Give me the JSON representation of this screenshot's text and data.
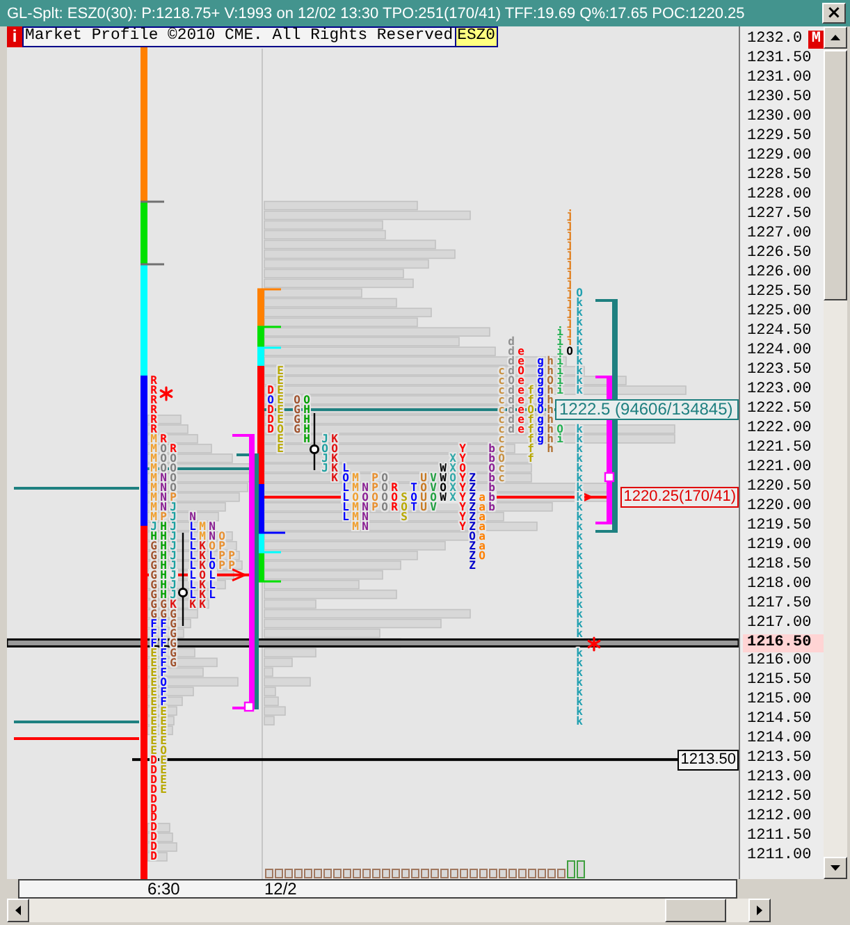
{
  "window": {
    "title": "GL-Splt: ESZ0(30): P:1218.75+ V:1993 on 12/02 13:30 TPO:251(170/41) TFF:19.69 Q%:17.65 POC:1220.25",
    "close_button": "×"
  },
  "header": {
    "info_button": "i",
    "notice": "Market Profile ©2010 CME. All Rights Reserved",
    "symbol": "ESZ0"
  },
  "chart": {
    "sessions": [
      {
        "columns": [
          {
            "runs": [
              {
                "text": "RRRRRR",
                "color": "#ff0000"
              },
              {
                "text": "MMMMMMMMM",
                "color": "#f0a030"
              },
              {
                "text": "J",
                "color": "#1ca0a0"
              },
              {
                "text": "H",
                "color": "#00a000"
              },
              {
                "text": "GGGGGGGG",
                "color": "#a0522d"
              },
              {
                "text": "FFF",
                "color": "#0000ff"
              },
              {
                "text": "EEEEEEEEEEE",
                "color": "#b8a800"
              },
              {
                "text": "DDDDDDDDDDD",
                "color": "#ff0000"
              }
            ]
          },
          {
            "runs": [
              {
                "text": "R",
                "color": "#ff0000"
              },
              {
                "text": "OOO",
                "color": "#808080"
              },
              {
                "text": "NNNN",
                "color": "#8b2094"
              },
              {
                "text": "P",
                "color": "#e89030"
              },
              {
                "text": "HHHHHHHH",
                "color": "#00a000"
              },
              {
                "text": "GG",
                "color": "#a0522d"
              },
              {
                "text": "FFFFFFOFF",
                "color": "#0000ff"
              },
              {
                "text": "EEEEOEEEE",
                "color": "#b8a800"
              }
            ]
          },
          {
            "runs": [
              {
                "text": "R",
                "color": "#ff0000"
              },
              {
                "text": "OOOO",
                "color": "#808080"
              },
              {
                "text": "P",
                "color": "#e89030"
              },
              {
                "text": "JJJJJJJJJJ",
                "color": "#1ca0a0"
              },
              {
                "text": "K",
                "color": "#e01010"
              },
              {
                "text": "GGGGGG",
                "color": "#a0522d"
              }
            ]
          },
          {
            "runs": [
              {
                "text": "N",
                "color": "#8b2094"
              },
              {
                "text": "LLLLLLLL",
                "color": "#0000ff"
              },
              {
                "text": "K",
                "color": "#e01010"
              }
            ]
          },
          {
            "runs": [
              {
                "text": "MM",
                "color": "#f0a030"
              },
              {
                "text": "KKKOKKK",
                "color": "#e01010"
              }
            ]
          },
          {
            "runs": [
              {
                "text": "NN",
                "color": "#8b2094"
              },
              {
                "text": "O",
                "color": "#e89030"
              },
              {
                "text": "LOLLL",
                "color": "#0000ff"
              }
            ]
          },
          {
            "runs": [
              {
                "text": "OPPP",
                "color": "#e89030"
              }
            ]
          },
          {
            "runs": [
              {
                "text": "PP",
                "color": "#e89030"
              }
            ]
          }
        ]
      },
      {
        "columns": [
          {
            "runs": [
              {
                "text": "D",
                "color": "#ff0000"
              },
              {
                "text": "O",
                "color": "#0000ff"
              },
              {
                "text": "DDD",
                "color": "#ff0000"
              }
            ]
          },
          {
            "runs": [
              {
                "text": "EEEEEEOEE",
                "color": "#b8a800"
              }
            ]
          },
          {
            "runs": [
              {
                "text": "OGGG",
                "color": "#a0522d"
              }
            ]
          },
          {
            "runs": [
              {
                "text": "OHHHH",
                "color": "#00a000"
              }
            ]
          },
          {
            "runs": [
              {
                "text": "JOJJ",
                "color": "#1ca0a0"
              }
            ]
          },
          {
            "runs": [
              {
                "text": "KOKKK",
                "color": "#e01010"
              }
            ]
          },
          {
            "runs": [
              {
                "text": "LOLLLL",
                "color": "#0000ff"
              }
            ]
          },
          {
            "runs": [
              {
                "text": "MMOMMM",
                "color": "#f0a030"
              }
            ]
          },
          {
            "runs": [
              {
                "text": "NONNN",
                "color": "#8b2094"
              }
            ]
          },
          {
            "runs": [
              {
                "text": "PPOP",
                "color": "#e89030"
              }
            ]
          },
          {
            "runs": [
              {
                "text": "OOOO",
                "color": "#808080"
              }
            ]
          },
          {
            "runs": [
              {
                "text": "ROR",
                "color": "#ff0000"
              }
            ]
          },
          {
            "runs": [
              {
                "text": "SOS",
                "color": "#b8a800"
              }
            ]
          },
          {
            "runs": [
              {
                "text": "TOT",
                "color": "#0000ff"
              }
            ]
          },
          {
            "runs": [
              {
                "text": "UOUU",
                "color": "#c87820"
              }
            ]
          },
          {
            "runs": [
              {
                "text": "VVOV",
                "color": "#20a040"
              }
            ]
          },
          {
            "runs": [
              {
                "text": "WWOW",
                "color": "#000000"
              }
            ]
          },
          {
            "runs": [
              {
                "text": "XXOXX",
                "color": "#30a8a8"
              }
            ]
          },
          {
            "runs": [
              {
                "text": "YYOYYYYYY",
                "color": "#ff0000"
              }
            ]
          },
          {
            "runs": [
              {
                "text": "ZZZZZZOZZZ",
                "color": "#0000cc"
              }
            ]
          },
          {
            "runs": [
              {
                "text": "aaaaaaO",
                "color": "#ff8000"
              }
            ]
          },
          {
            "runs": [
              {
                "text": "bbObbbb",
                "color": "#8b2094"
              }
            ]
          },
          {
            "runs": [
              {
                "text": "cccccccccOcc",
                "color": "#c89040"
              }
            ]
          },
          {
            "runs": [
              {
                "text": "ddddOddddd",
                "color": "#909090"
              }
            ]
          },
          {
            "runs": [
              {
                "text": "eeOeeeeee",
                "color": "#ff0000"
              }
            ]
          },
          {
            "runs": [
              {
                "text": "ffOfffff",
                "color": "#b8a800"
              }
            ]
          },
          {
            "runs": [
              {
                "text": "gggggOggg",
                "color": "#0000ff"
              }
            ]
          },
          {
            "runs": [
              {
                "text": "hhOhhhhhhh",
                "color": "#b07030"
              }
            ]
          },
          {
            "runs": [
              {
                "text": "iiiiiii",
                "color": "#20b050"
              }
            ]
          },
          {
            "runs": [
              {
                "text": "Oi",
                "color": "#20b050"
              }
            ]
          },
          {
            "runs": [
              {
                "text": "jjjjjjjjjjjjjj",
                "color": "#e08020"
              },
              {
                "text": "O",
                "color": "#000000"
              }
            ]
          },
          {
            "runs": [
              {
                "text": "Okkkkkkkkkk",
                "color": "#20a0b0"
              }
            ]
          },
          {
            "runs": [
              {
                "text": "kkkkkkkkkkkkkkkkkkkkkk",
                "color": "#20a0b0"
              }
            ]
          },
          {
            "runs": [
              {
                "text": "kkkkkkkk",
                "color": "#20a0b0"
              }
            ]
          }
        ]
      }
    ],
    "labels": [
      {
        "kind": "vwap",
        "text": "1222.5 (94606/134845)"
      },
      {
        "kind": "poc",
        "text": "1220.25(170/41)"
      },
      {
        "kind": "level",
        "text": "1213.50"
      }
    ]
  },
  "price_axis": {
    "mode_button": "M",
    "labels": [
      {
        "text": "1232.0",
        "highlighted": false
      },
      {
        "text": "1231.50",
        "highlighted": false
      },
      {
        "text": "1231.00",
        "highlighted": false
      },
      {
        "text": "1230.50",
        "highlighted": false
      },
      {
        "text": "1230.00",
        "highlighted": false
      },
      {
        "text": "1229.50",
        "highlighted": false
      },
      {
        "text": "1229.00",
        "highlighted": false
      },
      {
        "text": "1228.50",
        "highlighted": false
      },
      {
        "text": "1228.00",
        "highlighted": false
      },
      {
        "text": "1227.50",
        "highlighted": false
      },
      {
        "text": "1227.00",
        "highlighted": false
      },
      {
        "text": "1226.50",
        "highlighted": false
      },
      {
        "text": "1226.00",
        "highlighted": false
      },
      {
        "text": "1225.50",
        "highlighted": false
      },
      {
        "text": "1225.00",
        "highlighted": false
      },
      {
        "text": "1224.50",
        "highlighted": false
      },
      {
        "text": "1224.00",
        "highlighted": false
      },
      {
        "text": "1223.50",
        "highlighted": false
      },
      {
        "text": "1223.00",
        "highlighted": false
      },
      {
        "text": "1222.50",
        "highlighted": false
      },
      {
        "text": "1222.00",
        "highlighted": false
      },
      {
        "text": "1221.50",
        "highlighted": false
      },
      {
        "text": "1221.00",
        "highlighted": false
      },
      {
        "text": "1220.50",
        "highlighted": false
      },
      {
        "text": "1220.00",
        "highlighted": false
      },
      {
        "text": "1219.50",
        "highlighted": false
      },
      {
        "text": "1219.00",
        "highlighted": false
      },
      {
        "text": "1218.50",
        "highlighted": false
      },
      {
        "text": "1218.00",
        "highlighted": false
      },
      {
        "text": "1217.50",
        "highlighted": false
      },
      {
        "text": "1217.00",
        "highlighted": false
      },
      {
        "text": "1216.50",
        "highlighted": true
      },
      {
        "text": "1216.00",
        "highlighted": false
      },
      {
        "text": "1215.50",
        "highlighted": false
      },
      {
        "text": "1215.00",
        "highlighted": false
      },
      {
        "text": "1214.50",
        "highlighted": false
      },
      {
        "text": "1214.00",
        "highlighted": false
      },
      {
        "text": "1213.50",
        "highlighted": false
      },
      {
        "text": "1213.00",
        "highlighted": false
      },
      {
        "text": "1212.50",
        "highlighted": false
      },
      {
        "text": "1212.00",
        "highlighted": false
      },
      {
        "text": "1211.50",
        "highlighted": false
      },
      {
        "text": "1211.00",
        "highlighted": false
      }
    ]
  },
  "time_axis": {
    "labels": [
      "6:30",
      "12/2"
    ]
  }
}
